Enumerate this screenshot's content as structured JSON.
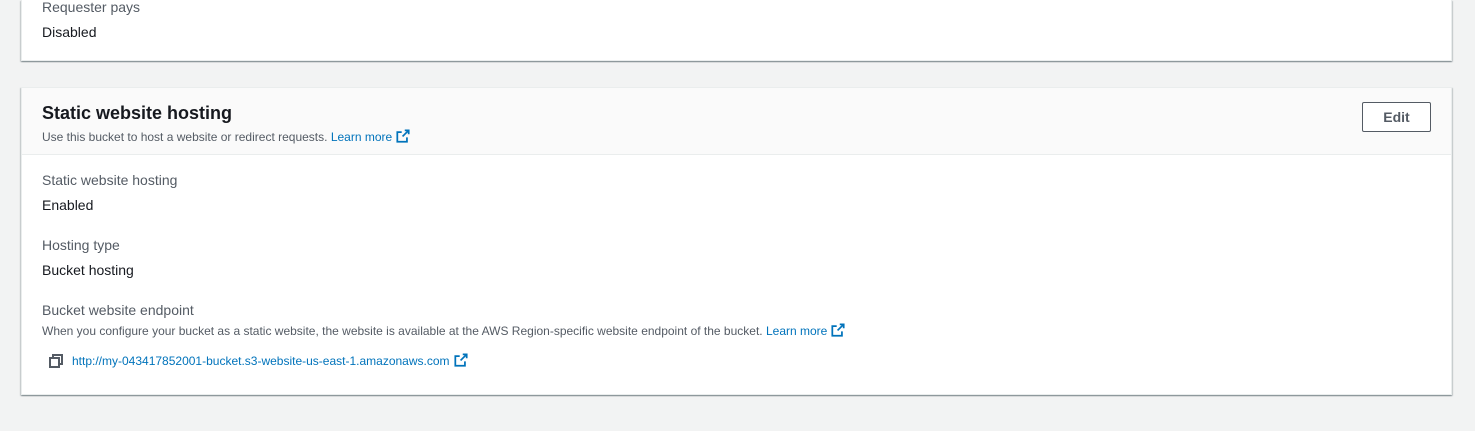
{
  "requester_pays": {
    "label": "Requester pays",
    "value": "Disabled"
  },
  "static_hosting_panel": {
    "title": "Static website hosting",
    "description": "Use this bucket to host a website or redirect requests.",
    "learn_more": "Learn more",
    "edit_button": "Edit",
    "fields": {
      "hosting_label": "Static website hosting",
      "hosting_value": "Enabled",
      "type_label": "Hosting type",
      "type_value": "Bucket hosting",
      "endpoint_label": "Bucket website endpoint",
      "endpoint_description": "When you configure your bucket as a static website, the website is available at the AWS Region-specific website endpoint of the bucket.",
      "endpoint_learn_more": "Learn more",
      "endpoint_url": "http://my-043417852001-bucket.s3-website-us-east-1.amazonaws.com"
    }
  },
  "colors": {
    "link": "#0073bb",
    "page_background": "#f2f3f3",
    "label_text": "#545b64"
  }
}
